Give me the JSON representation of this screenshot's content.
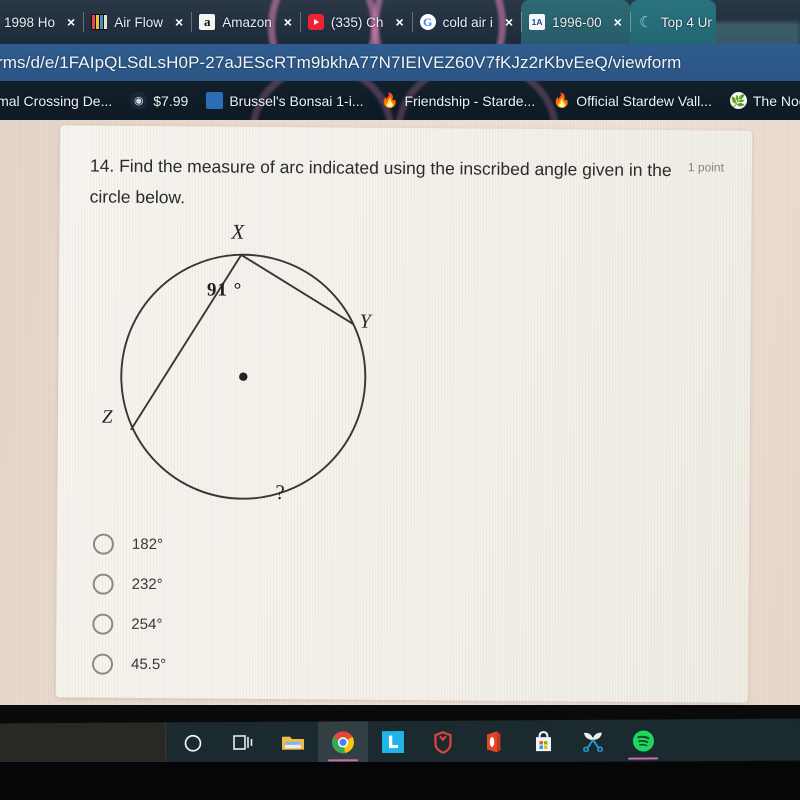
{
  "browser": {
    "tabs": [
      {
        "title": "1998 Ho",
        "favicon": "generic-icon",
        "close_label": "×"
      },
      {
        "title": "Air Flow",
        "favicon": "airflow-icon",
        "close_label": "×"
      },
      {
        "title": "Amazon",
        "favicon": "amazon-icon",
        "close_label": "×"
      },
      {
        "title": "(335) Ch",
        "favicon": "youtube-icon",
        "close_label": "×"
      },
      {
        "title": "cold air i",
        "favicon": "google-icon",
        "close_label": "×"
      },
      {
        "title": "1996-00",
        "favicon": "internet-archive-icon",
        "close_label": "×"
      },
      {
        "title": "Top 4 Ur",
        "favicon": "moon-icon",
        "close_label": "×"
      }
    ],
    "url": "rms/d/e/1FAIpQLSdLsH0P-27aJEScRTm9bkhA77N7IEIVEZ60V7fKJz2rKbvEeQ/viewform",
    "bookmarks": [
      {
        "label": "imal Crossing De...",
        "icon": "generic-icon"
      },
      {
        "label": "$7.99",
        "icon": "steam-icon"
      },
      {
        "label": "Brussel's Bonsai 1-i...",
        "icon": "folder-icon"
      },
      {
        "label": "Friendship - Starde...",
        "icon": "stardew-icon"
      },
      {
        "label": "Official Stardew Vall...",
        "icon": "stardew-icon"
      },
      {
        "label": "The Nook Bui",
        "icon": "leaf-icon"
      }
    ]
  },
  "form": {
    "question_number": "14.",
    "question_text": "14. Find the measure of arc indicated using the inscribed angle given in the circle below.",
    "points": "1 point",
    "figure": {
      "vertex_x_label": "X",
      "vertex_y_label": "Y",
      "vertex_z_label": "Z",
      "angle_label": "91 °",
      "unknown_arc_label": "?",
      "center_dot": "center-point"
    },
    "options": [
      {
        "label": "182°",
        "selected": false
      },
      {
        "label": "232°",
        "selected": false
      },
      {
        "label": "254°",
        "selected": false
      },
      {
        "label": "45.5°",
        "selected": false
      }
    ]
  },
  "taskbar": {
    "items": [
      {
        "name": "cortana-icon",
        "label": "Cortana"
      },
      {
        "name": "task-view-icon",
        "label": "Task View"
      },
      {
        "name": "file-explorer-icon",
        "label": "File Explorer"
      },
      {
        "name": "chrome-icon",
        "label": "Google Chrome"
      },
      {
        "name": "lightshot-icon",
        "label": "Lightshot"
      },
      {
        "name": "brave-icon",
        "label": "Brave"
      },
      {
        "name": "office-icon",
        "label": "Microsoft Office"
      },
      {
        "name": "microsoft-store-icon",
        "label": "Microsoft Store"
      },
      {
        "name": "snip-sketch-icon",
        "label": "Snip & Sketch"
      },
      {
        "name": "spotify-icon",
        "label": "Spotify"
      }
    ]
  },
  "colors": {
    "urlbar": "#2f5c8d",
    "tabstrip": "#2b3845",
    "page_bg": "#ecdcd1",
    "card_bg": "#f3f1ea",
    "ink": "#2b2b2b"
  }
}
